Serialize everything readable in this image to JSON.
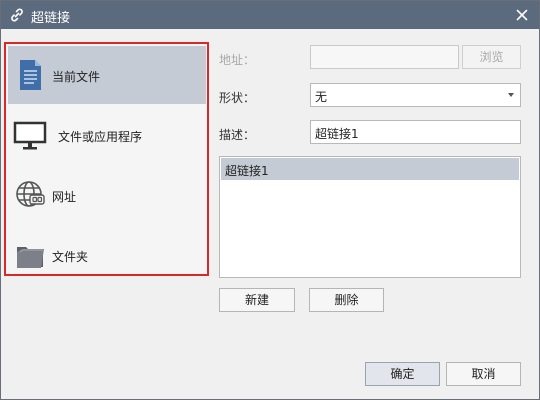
{
  "dialog": {
    "title": "超链接",
    "icons": {
      "title": "link-icon",
      "close": "close-icon"
    }
  },
  "nav": {
    "items": [
      {
        "label": "当前文件",
        "icon": "document-icon",
        "active": true
      },
      {
        "label": "文件或应用程序",
        "icon": "monitor-icon",
        "active": false
      },
      {
        "label": "网址",
        "icon": "globe-link-icon",
        "active": false
      },
      {
        "label": "文件夹",
        "icon": "folder-icon",
        "active": false
      }
    ]
  },
  "form": {
    "address_label": "地址：",
    "address_value": "",
    "browse_label": "浏览",
    "shape_label": "形状：",
    "shape_value": "无",
    "desc_label": "描述：",
    "desc_value": "超链接1"
  },
  "list": {
    "items": [
      "超链接1"
    ],
    "selected_index": 0
  },
  "actions": {
    "new_label": "新建",
    "delete_label": "删除",
    "ok_label": "确定",
    "cancel_label": "取消"
  },
  "colors": {
    "titlebar": "#5c6a7e",
    "selection": "#c5cbd4",
    "highlight_border": "#d62a2a"
  }
}
